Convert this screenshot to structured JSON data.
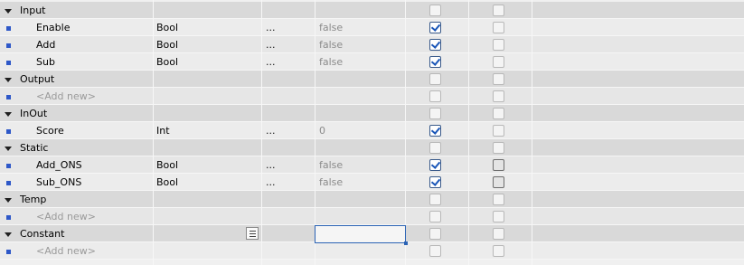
{
  "rows": [
    {
      "kind": "group",
      "name": "Input"
    },
    {
      "kind": "item",
      "name": "Enable",
      "type": "Bool",
      "offset": "...",
      "default": "false",
      "retain": true,
      "accessible": false
    },
    {
      "kind": "item",
      "name": "Add",
      "type": "Bool",
      "offset": "...",
      "default": "false",
      "retain": true,
      "accessible": false
    },
    {
      "kind": "item",
      "name": "Sub",
      "type": "Bool",
      "offset": "...",
      "default": "false",
      "retain": true,
      "accessible": false
    },
    {
      "kind": "group",
      "name": "Output"
    },
    {
      "kind": "placeholder",
      "name": "<Add new>"
    },
    {
      "kind": "group",
      "name": "InOut"
    },
    {
      "kind": "item",
      "name": "Score",
      "type": "Int",
      "offset": "...",
      "default": "0",
      "retain": true,
      "accessible": false
    },
    {
      "kind": "group",
      "name": "Static"
    },
    {
      "kind": "item",
      "name": "Add_ONS",
      "type": "Bool",
      "offset": "...",
      "default": "false",
      "retain": true,
      "accessible": false,
      "accessible_dark": true
    },
    {
      "kind": "item",
      "name": "Sub_ONS",
      "type": "Bool",
      "offset": "...",
      "default": "false",
      "retain": true,
      "accessible": false,
      "accessible_dark": true
    },
    {
      "kind": "group",
      "name": "Temp"
    },
    {
      "kind": "placeholder",
      "name": "<Add new>"
    },
    {
      "kind": "group",
      "name": "Constant"
    },
    {
      "kind": "placeholder",
      "name": "<Add new>"
    }
  ],
  "icons": {
    "group": "expand-triangle-icon",
    "item": "variable-square-icon",
    "list": "list-browse-icon"
  },
  "colors": {
    "group_bg": "#d9d9d9",
    "item_bg": "#ececec",
    "square": "#2e58c8",
    "check": "#1a56b8",
    "selection": "#2b63b5",
    "muted_text": "#8b8b8b"
  }
}
